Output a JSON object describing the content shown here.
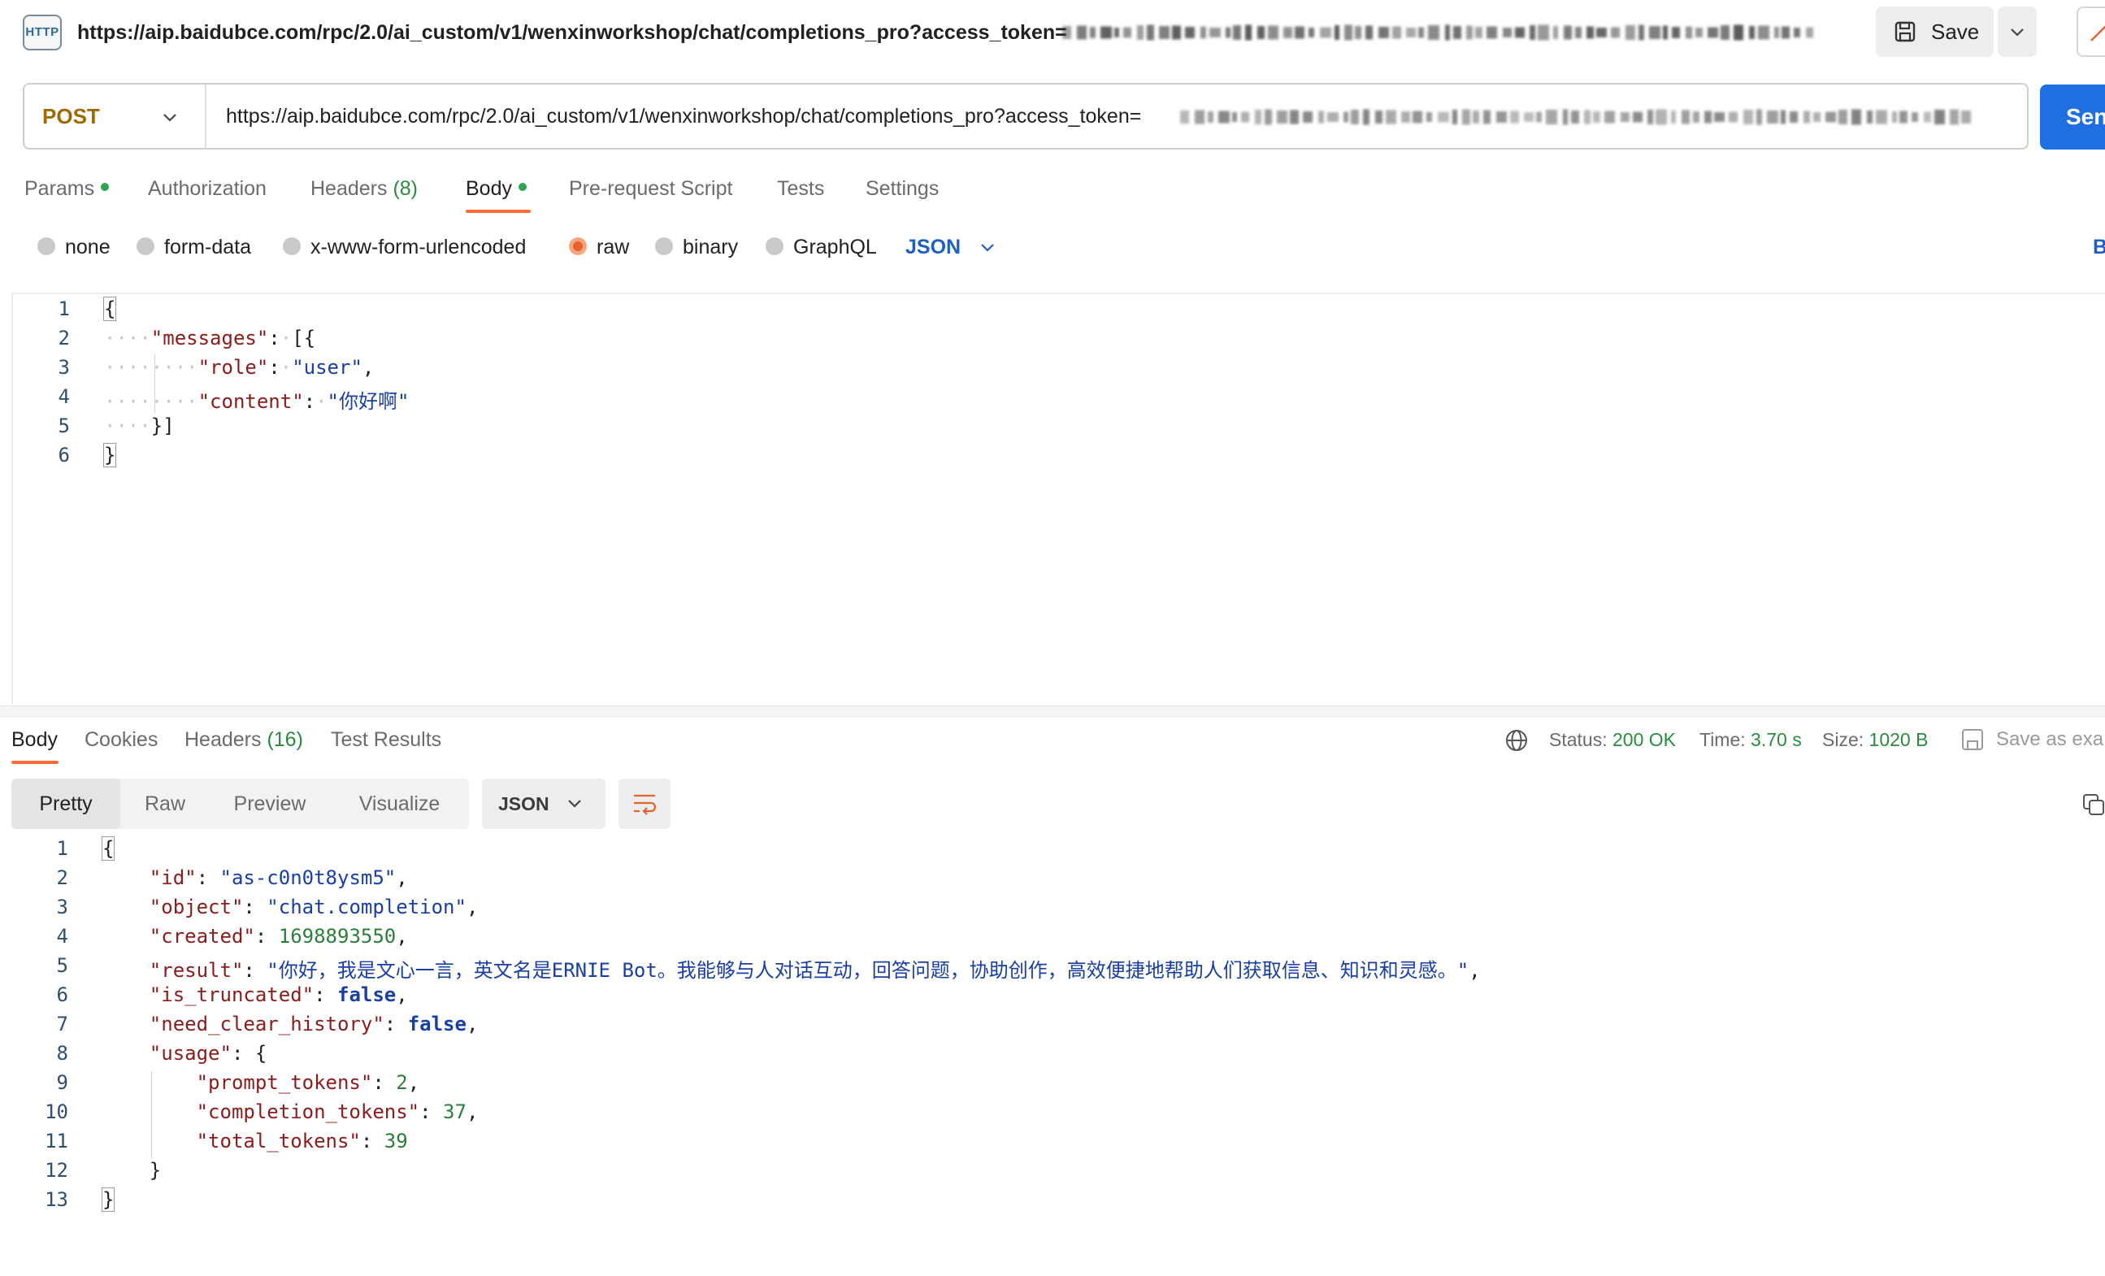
{
  "request_title": {
    "url": "https://aip.baidubce.com/rpc/2.0/ai_custom/v1/wenxinworkshop/chat/completions_pro?access_token=",
    "http_badge": "HTTP",
    "save_label": "Save"
  },
  "urlbar": {
    "method": "POST",
    "url": "https://aip.baidubce.com/rpc/2.0/ai_custom/v1/wenxinworkshop/chat/completions_pro?access_token=",
    "send_label": "Sen"
  },
  "request_tabs": [
    {
      "label": "Params",
      "dot": true
    },
    {
      "label": "Authorization"
    },
    {
      "label": "Headers",
      "count": "(8)"
    },
    {
      "label": "Body",
      "dot": true,
      "active": true
    },
    {
      "label": "Pre-request Script"
    },
    {
      "label": "Tests"
    },
    {
      "label": "Settings"
    }
  ],
  "body_types": {
    "options": [
      "none",
      "form-data",
      "x-www-form-urlencoded",
      "raw",
      "binary",
      "GraphQL"
    ],
    "selected": "raw",
    "language": "JSON",
    "beautify_label": "B"
  },
  "request_body": {
    "line_numbers": [
      "1",
      "2",
      "3",
      "4",
      "5",
      "6"
    ],
    "open_brace": "{",
    "messages_key": "\"messages\"",
    "messages_open": "[{",
    "role_key": "\"role\"",
    "role_value": "\"user\"",
    "content_key": "\"content\"",
    "content_value": "\"你好啊\"",
    "messages_close": "}]",
    "close_brace": "}"
  },
  "response_tabs": [
    {
      "label": "Body",
      "active": true
    },
    {
      "label": "Cookies"
    },
    {
      "label": "Headers",
      "count": "(16)"
    },
    {
      "label": "Test Results"
    }
  ],
  "response_status": {
    "status_label": "Status:",
    "status_value": "200 OK",
    "time_label": "Time:",
    "time_value": "3.70 s",
    "size_label": "Size:",
    "size_value": "1020 B",
    "save_example_label": "Save as exa"
  },
  "response_toolbar": {
    "views": [
      "Pretty",
      "Raw",
      "Preview",
      "Visualize"
    ],
    "active_view": "Pretty",
    "format": "JSON"
  },
  "response_body": {
    "line_numbers": [
      "1",
      "2",
      "3",
      "4",
      "5",
      "6",
      "7",
      "8",
      "9",
      "10",
      "11",
      "12",
      "13"
    ],
    "open_brace": "{",
    "id_key": "\"id\"",
    "id_value": "\"as-c0n0t8ysm5\"",
    "object_key": "\"object\"",
    "object_value": "\"chat.completion\"",
    "created_key": "\"created\"",
    "created_value": "1698893550",
    "result_key": "\"result\"",
    "result_value": "\"你好，我是文心一言，英文名是ERNIE Bot。我能够与人对话互动，回答问题，协助创作，高效便捷地帮助人们获取信息、知识和灵感。\"",
    "is_truncated_key": "\"is_truncated\"",
    "is_truncated_value": "false",
    "need_clear_history_key": "\"need_clear_history\"",
    "need_clear_history_value": "false",
    "usage_key": "\"usage\"",
    "usage_open": "{",
    "prompt_tokens_key": "\"prompt_tokens\"",
    "prompt_tokens_value": "2",
    "completion_tokens_key": "\"completion_tokens\"",
    "completion_tokens_value": "37",
    "total_tokens_key": "\"total_tokens\"",
    "total_tokens_value": "39",
    "usage_close": "}",
    "close_brace": "}"
  },
  "colors": {
    "accent": "#ff6c37",
    "send_button": "#1f6fe0",
    "method_post": "#a06a00",
    "status_ok": "#2a8a3e",
    "json_key": "#8a1c1c",
    "json_string": "#1a3fa3",
    "json_number": "#2d7d3a"
  }
}
